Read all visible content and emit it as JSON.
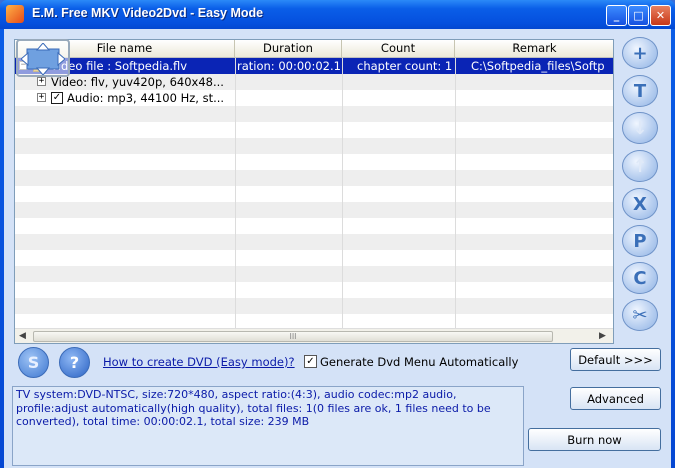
{
  "window": {
    "title": "E.M. Free MKV Video2Dvd - Easy Mode"
  },
  "list": {
    "columns": [
      "File name",
      "Duration",
      "Count",
      "Remark"
    ],
    "rows": [
      {
        "name": "video file : Softpedia.flv",
        "duration": "ration: 00:00:02.1",
        "count": "chapter count: 1",
        "remark": "C:\\Softpedia_files\\Softp",
        "selected": true
      },
      {
        "name": "Video: flv, yuv420p, 640x48...",
        "duration": "",
        "count": "",
        "remark": ""
      },
      {
        "name": "Audio: mp3, 44100 Hz, st...",
        "duration": "",
        "count": "",
        "remark": ""
      }
    ],
    "scroll_grip": "III"
  },
  "toolbar_right": [
    {
      "name": "add-button",
      "glyph": "+"
    },
    {
      "name": "title-button",
      "glyph": "T"
    },
    {
      "name": "move-down-button",
      "glyph": "↓"
    },
    {
      "name": "move-up-button",
      "glyph": "↑"
    },
    {
      "name": "remove-button",
      "glyph": "X"
    },
    {
      "name": "preview-button",
      "glyph": "P"
    },
    {
      "name": "chapter-button",
      "glyph": "C"
    },
    {
      "name": "cut-button",
      "glyph": "✂"
    }
  ],
  "bottom": {
    "s_glyph": "S",
    "help_glyph": "?",
    "howto_link": "How to create DVD (Easy mode)?",
    "gen_menu_label": "Generate Dvd Menu Automatically",
    "gen_menu_checked": "✓",
    "info_text": "TV system:DVD-NTSC, size:720*480, aspect ratio:(4:3), audio codec:mp2 audio, profile:adjust automatically(high quality), total files: 1(0 files are ok, 1 files need to be converted), total time: 00:00:02.1, total size: 239 MB",
    "default_label": "Default >>>",
    "advanced_label": "Advanced",
    "burn_label": "Burn now"
  },
  "colors": {
    "selection": "#0a24b5",
    "title_bar": "#0a5ee8",
    "client": "#d4e2f7"
  }
}
